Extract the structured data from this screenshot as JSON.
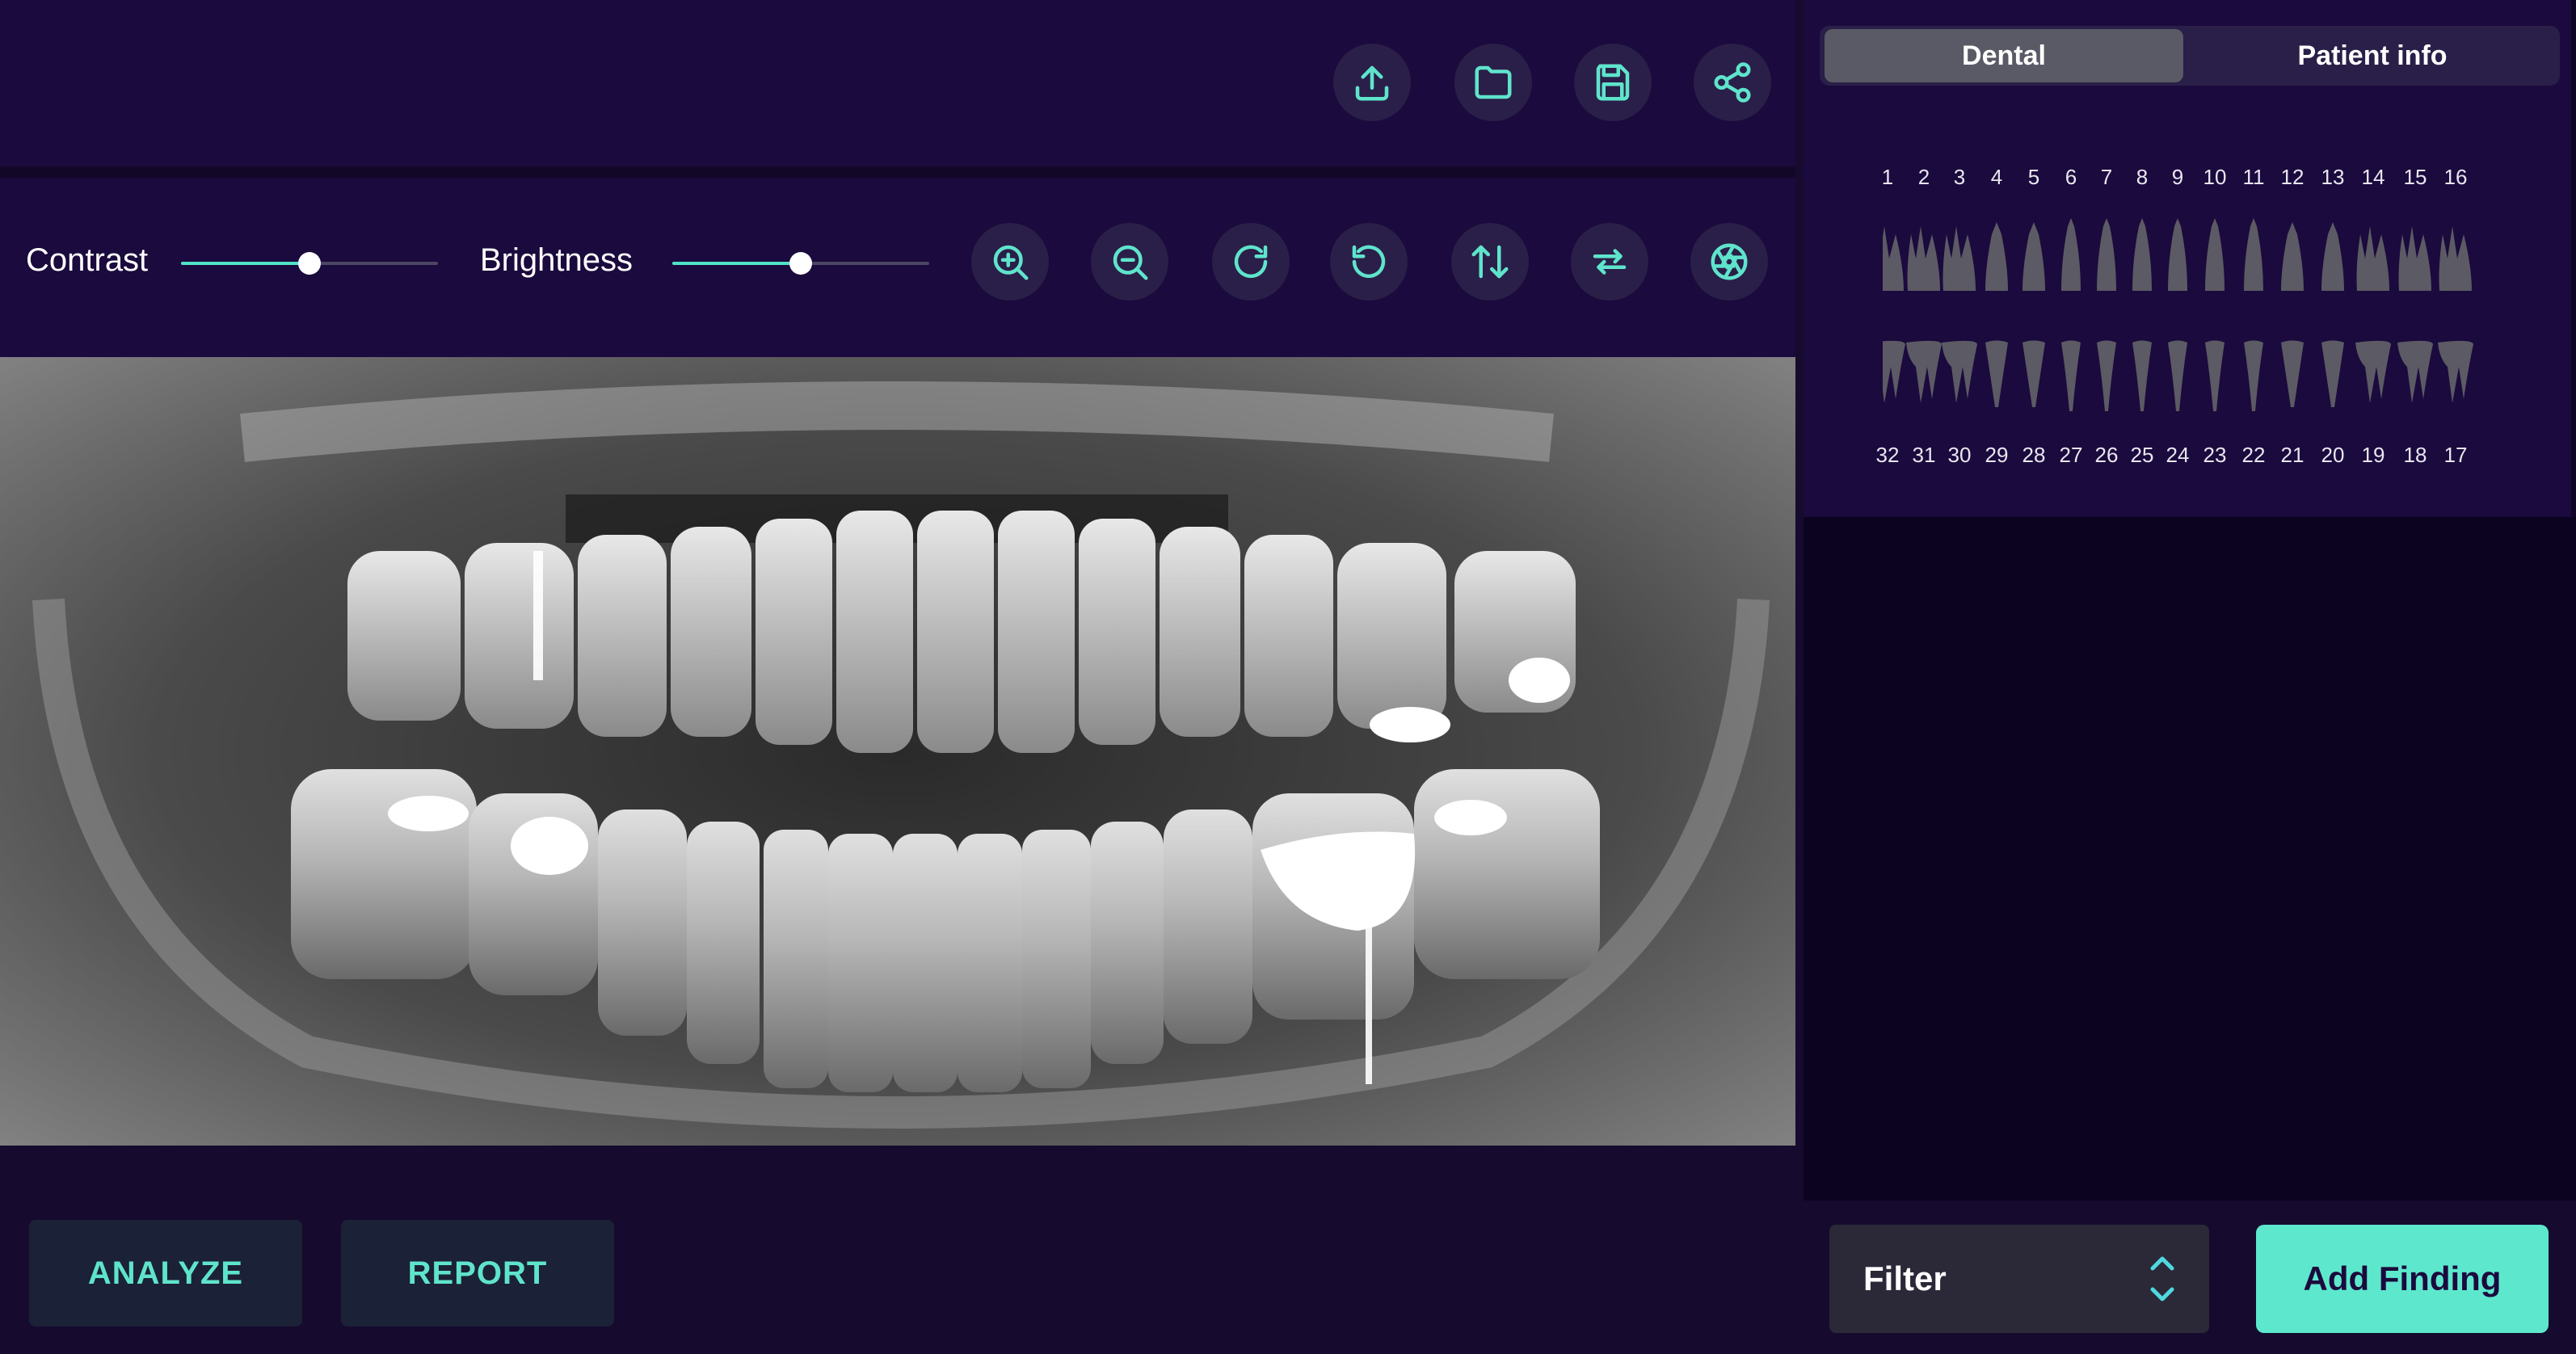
{
  "toolbar": {
    "icons": [
      "upload-icon",
      "folder-icon",
      "save-icon",
      "share-icon"
    ]
  },
  "adjust": {
    "contrast_label": "Contrast",
    "contrast_value": 0.5,
    "brightness_label": "Brightness",
    "brightness_value": 0.5,
    "tools": [
      "zoom-in-icon",
      "zoom-out-icon",
      "rotate-right-icon",
      "rotate-left-icon",
      "flip-vertical-icon",
      "flip-horizontal-icon",
      "aperture-icon"
    ]
  },
  "actions": {
    "analyze_label": "ANALYZE",
    "report_label": "REPORT"
  },
  "tabs": {
    "dental_label": "Dental",
    "patient_label": "Patient info",
    "active": "Dental"
  },
  "upper_teeth": [
    "1",
    "2",
    "3",
    "4",
    "5",
    "6",
    "7",
    "8",
    "9",
    "10",
    "11",
    "12",
    "13",
    "14",
    "15",
    "16"
  ],
  "lower_teeth": [
    "32",
    "31",
    "30",
    "29",
    "28",
    "27",
    "26",
    "25",
    "24",
    "23",
    "22",
    "21",
    "20",
    "19",
    "18",
    "17"
  ],
  "filter": {
    "label": "Filter"
  },
  "add_finding_label": "Add Finding",
  "colors": {
    "accent": "#5de8cd",
    "panel_bg": "#1b0a3d",
    "button_bg": "#2a1f48"
  }
}
